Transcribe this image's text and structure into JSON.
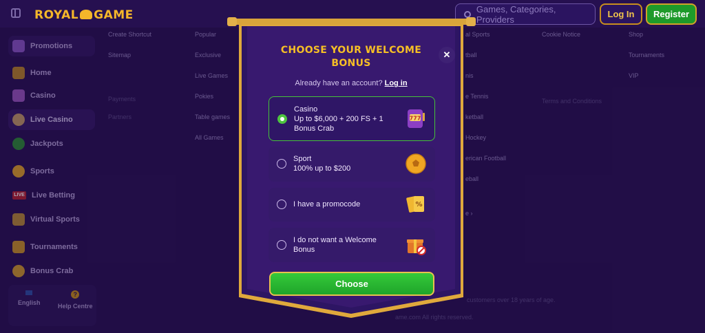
{
  "header": {
    "logo_left": "ROYAL",
    "logo_right": "GAME",
    "search_placeholder": "Games, Categories, Providers",
    "login_label": "Log In",
    "register_label": "Register"
  },
  "sidebar": {
    "items": [
      {
        "label": "Promotions",
        "icon": "gift-box-icon"
      },
      {
        "label": "Home",
        "icon": "home-icon"
      },
      {
        "label": "Casino",
        "icon": "slot-machine-icon"
      },
      {
        "label": "Live Casino",
        "icon": "dealer-icon"
      },
      {
        "label": "Jackpots",
        "icon": "clover-icon"
      },
      {
        "label": "Sports",
        "icon": "football-icon"
      },
      {
        "label": "Live Betting",
        "icon": "live-badge",
        "badge": "LIVE"
      },
      {
        "label": "Virtual Sports",
        "icon": "gamepad-icon"
      },
      {
        "label": "Tournaments",
        "icon": "trophy-icon"
      },
      {
        "label": "Bonus Crab",
        "icon": "claw-icon"
      }
    ],
    "footer": {
      "language": "English",
      "help": "Help Centre"
    }
  },
  "footer_links": {
    "col1": [
      "Create Shortcut",
      "Sitemap"
    ],
    "col1_headings": [
      "Payments",
      "Partners"
    ],
    "col2": [
      "Popular",
      "Exclusive",
      "Live Games",
      "Pokies",
      "Table games",
      "All Games"
    ],
    "col3": [
      "al Sports",
      "tball",
      "nis",
      "e Tennis",
      "ketball",
      "Hockey",
      "erican Football",
      "eball",
      "e"
    ],
    "col4": [
      "Cookie Notice"
    ],
    "col4_heading": "Terms and Conditions",
    "col5": [
      "Shop",
      "Tournaments",
      "VIP"
    ],
    "age_note": "customers over 18 years of age.",
    "rights": "ame.com All rights reserved."
  },
  "modal": {
    "title_line1": "CHOOSE YOUR WELCOME",
    "title_line2": "BONUS",
    "close_symbol": "✕",
    "account_prompt": "Already have an account?",
    "login_link": "Log in",
    "options": [
      {
        "line1": "Casino",
        "line2": "Up to $6,000 + 200 FS + 1",
        "line3": "Bonus Crab",
        "selected": true,
        "icon": "slot-777-icon"
      },
      {
        "line1": "Sport",
        "line2": "100% up to $200",
        "selected": false,
        "icon": "soccer-ball-icon"
      },
      {
        "line1": "I have a promocode",
        "selected": false,
        "icon": "promo-tickets-icon"
      },
      {
        "line1": "I do not want a Welcome",
        "line2": "Bonus",
        "selected": false,
        "icon": "no-gift-icon"
      }
    ],
    "choose_label": "Choose"
  },
  "colors": {
    "background": "#2a1257",
    "gold": "#f6bf25",
    "green": "#35c93a",
    "panel": "#351a6a"
  }
}
